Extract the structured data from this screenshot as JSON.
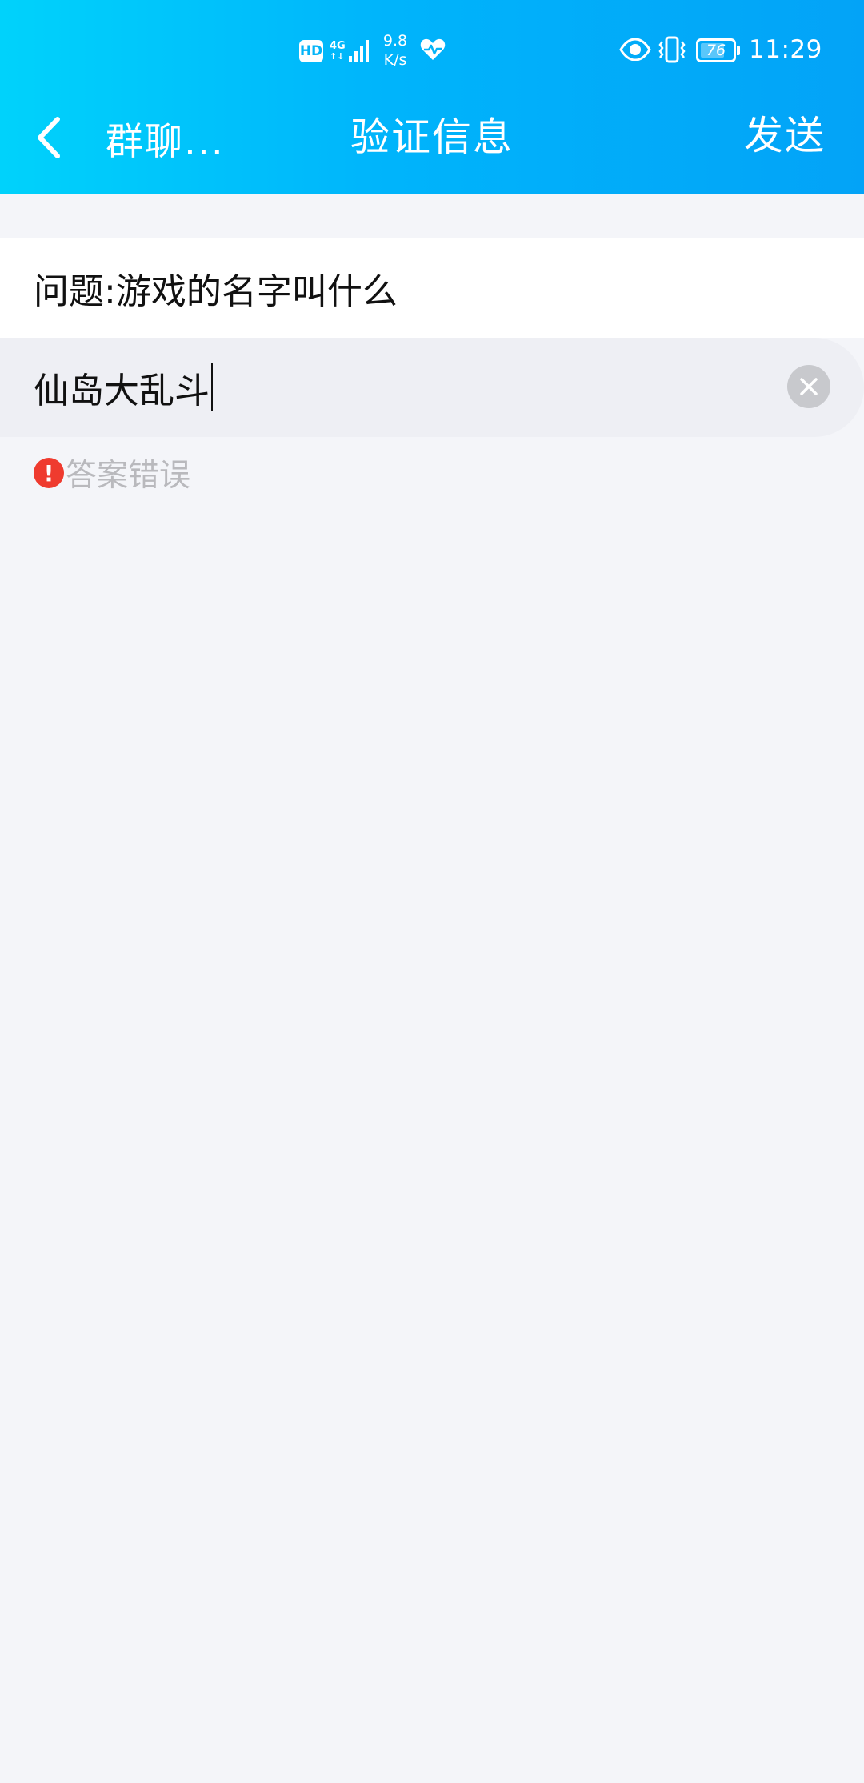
{
  "status_bar": {
    "hd_label": "HD",
    "net_type": "4G",
    "speed_value": "9.8",
    "speed_unit": "K/s",
    "battery_level": "76",
    "battery_fraction": 0.76,
    "time": "11:29"
  },
  "nav": {
    "back_label": "群聊...",
    "title": "验证信息",
    "send_label": "发送"
  },
  "form": {
    "question": "问题:游戏的名字叫什么",
    "answer_value": "仙岛大乱斗",
    "error_icon_glyph": "!",
    "error_text": "答案错误"
  },
  "colors": {
    "header_gradient_start": "#00d2fb",
    "header_gradient_end": "#03a3f7",
    "page_background": "#f4f5f9",
    "error_red": "#ef3b2f",
    "error_text_gray": "#b9b9bd",
    "clear_button_gray": "#c8c9cd"
  },
  "icons": {
    "back": "chevron-left-icon",
    "clear": "close-circle-icon",
    "error": "exclamation-circle-icon",
    "health": "heart-pulse-icon",
    "eye": "eye-icon",
    "vibrate": "vibrate-icon",
    "signal": "signal-bars-icon",
    "battery": "battery-icon"
  }
}
